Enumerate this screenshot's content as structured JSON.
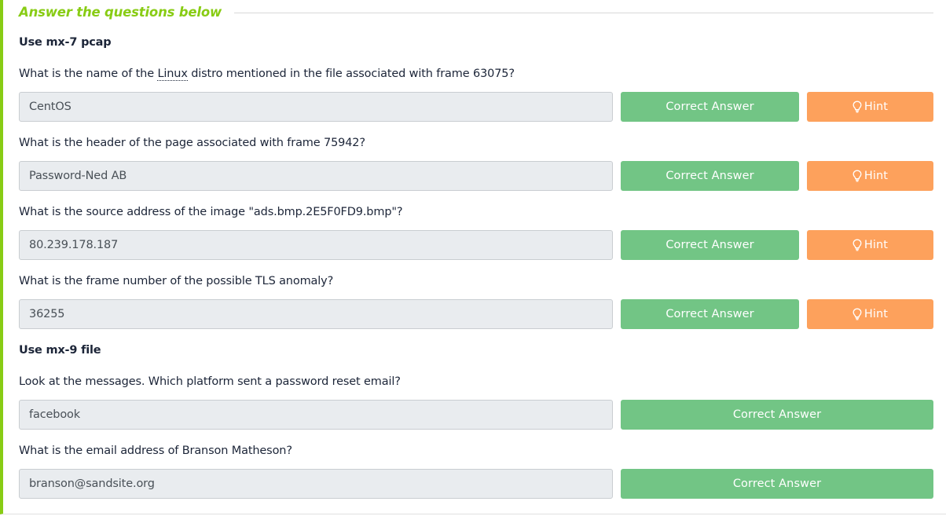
{
  "panel": {
    "title": "Answer the questions below"
  },
  "colors": {
    "accent": "#88cc14",
    "correct_button": "#72c585",
    "hint_button": "#fda15c",
    "field_background": "#e9ecef"
  },
  "sections": [
    {
      "label": "Use mx-7 pcap",
      "questions": [
        {
          "text_before": "What is the name of the ",
          "text_abbr": "Linux",
          "text_after": " distro mentioned in the file associated with frame 63075?",
          "answer": "CentOS",
          "correct_label": "Correct Answer",
          "hint_label": "Hint",
          "hint_icon": "lightbulb-icon"
        },
        {
          "text": "What is the header of the page associated with frame 75942?",
          "answer": "Password-Ned AB",
          "correct_label": "Correct Answer",
          "hint_label": "Hint",
          "hint_icon": "lightbulb-icon"
        },
        {
          "text": "What is the source address of the image \"ads.bmp.2E5F0FD9.bmp\"?",
          "answer": "80.239.178.187",
          "correct_label": "Correct Answer",
          "hint_label": "Hint",
          "hint_icon": "lightbulb-icon"
        },
        {
          "text": "What is the frame number of the possible TLS anomaly?",
          "answer": "36255",
          "correct_label": "Correct Answer",
          "hint_label": "Hint",
          "hint_icon": "lightbulb-icon"
        }
      ]
    },
    {
      "label": "Use mx-9 file",
      "questions": [
        {
          "text": "Look at the messages. Which platform sent a password reset email?",
          "answer": "facebook",
          "correct_label": "Correct Answer"
        },
        {
          "text": "What is the email address of Branson Matheson?",
          "answer": "branson@sandsite.org",
          "correct_label": "Correct Answer"
        }
      ]
    }
  ]
}
